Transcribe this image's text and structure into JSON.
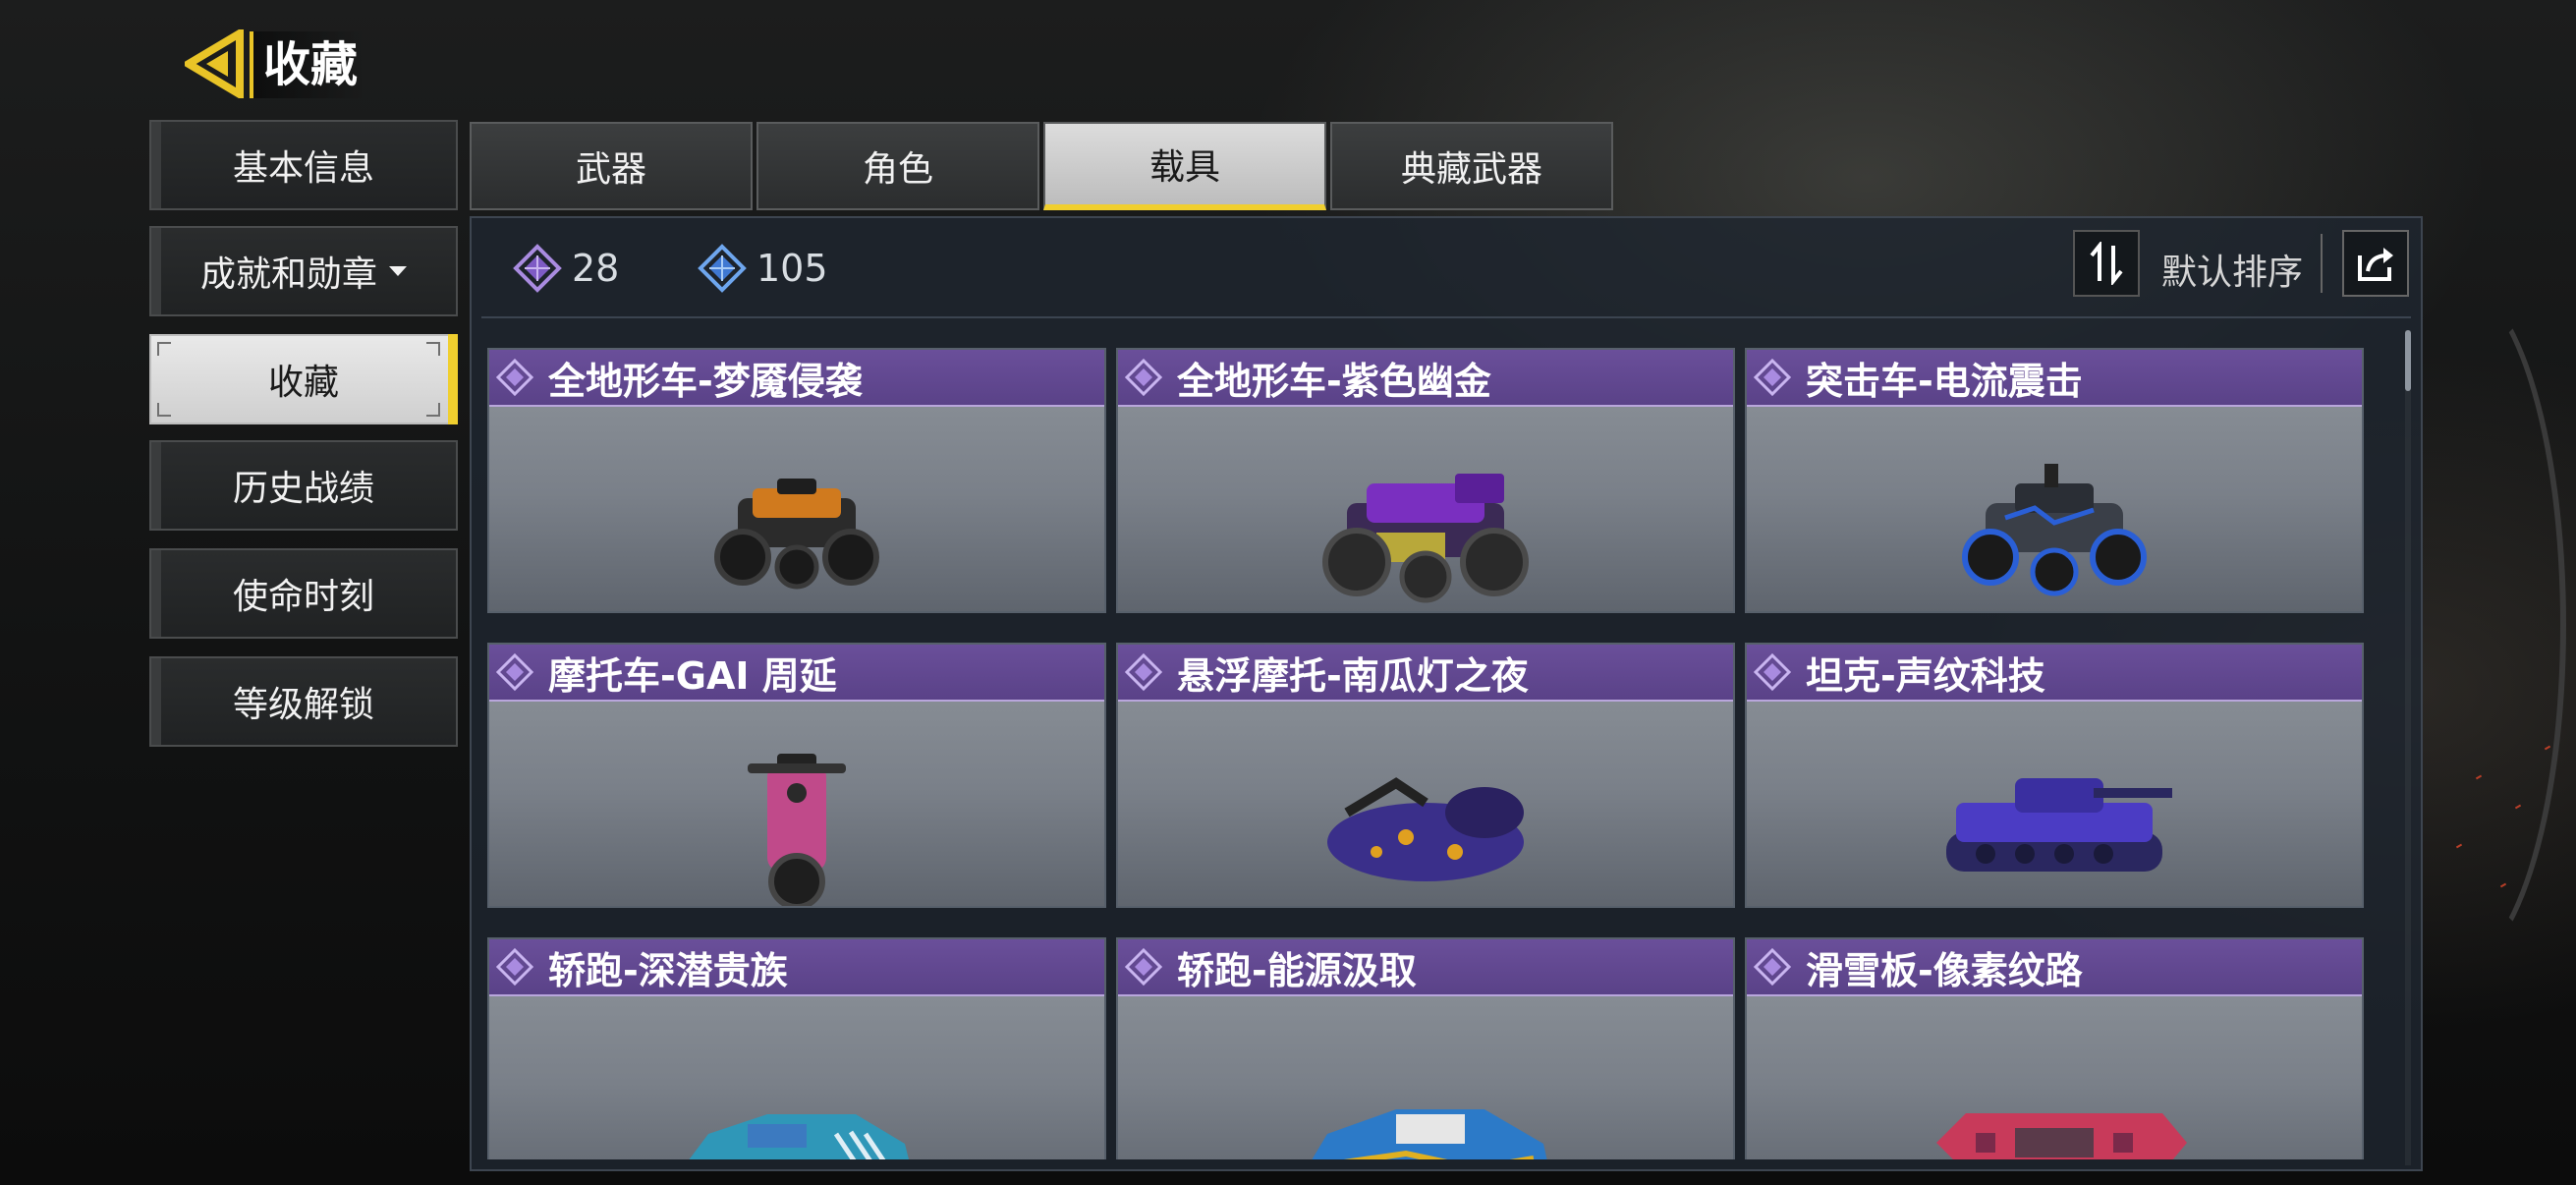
{
  "header": {
    "title": "收藏"
  },
  "sidebar": {
    "items": [
      {
        "label": "基本信息"
      },
      {
        "label": "成就和勋章"
      },
      {
        "label": "收藏"
      },
      {
        "label": "历史战绩"
      },
      {
        "label": "使命时刻"
      },
      {
        "label": "等级解锁"
      }
    ]
  },
  "tabs": [
    {
      "label": "武器"
    },
    {
      "label": "角色"
    },
    {
      "label": "载具"
    },
    {
      "label": "典藏武器"
    }
  ],
  "currency": {
    "purple": "28",
    "blue": "105"
  },
  "sort": {
    "label": "默认排序"
  },
  "items": [
    {
      "name": "全地形车-梦魇侵袭",
      "vehicle": "atv-icon",
      "color": "#d07a1e"
    },
    {
      "name": "全地形车-紫色幽金",
      "vehicle": "atv-icon",
      "color": "#7a2fc0"
    },
    {
      "name": "突击车-电流震击",
      "vehicle": "buggy-icon",
      "color": "#2a5fd6"
    },
    {
      "name": "摩托车-GAI 周延",
      "vehicle": "motorcycle-icon",
      "color": "#c04a8a"
    },
    {
      "name": "悬浮摩托-南瓜灯之夜",
      "vehicle": "hoverbike-icon",
      "color": "#3a2f8a"
    },
    {
      "name": "坦克-声纹科技",
      "vehicle": "tank-icon",
      "color": "#4b3cc4"
    },
    {
      "name": "轿跑-深潜贵族",
      "vehicle": "car-icon",
      "color": "#2f97b8"
    },
    {
      "name": "轿跑-能源汲取",
      "vehicle": "car-icon",
      "color": "#2c7ac8"
    },
    {
      "name": "滑雪板-像素纹路",
      "vehicle": "snowboard-icon",
      "color": "#c83a5a"
    }
  ],
  "colors": {
    "accent": "#f0cf2f",
    "rarity_purple": "#6a4f9a",
    "rarity_blue": "#3f78d2"
  }
}
